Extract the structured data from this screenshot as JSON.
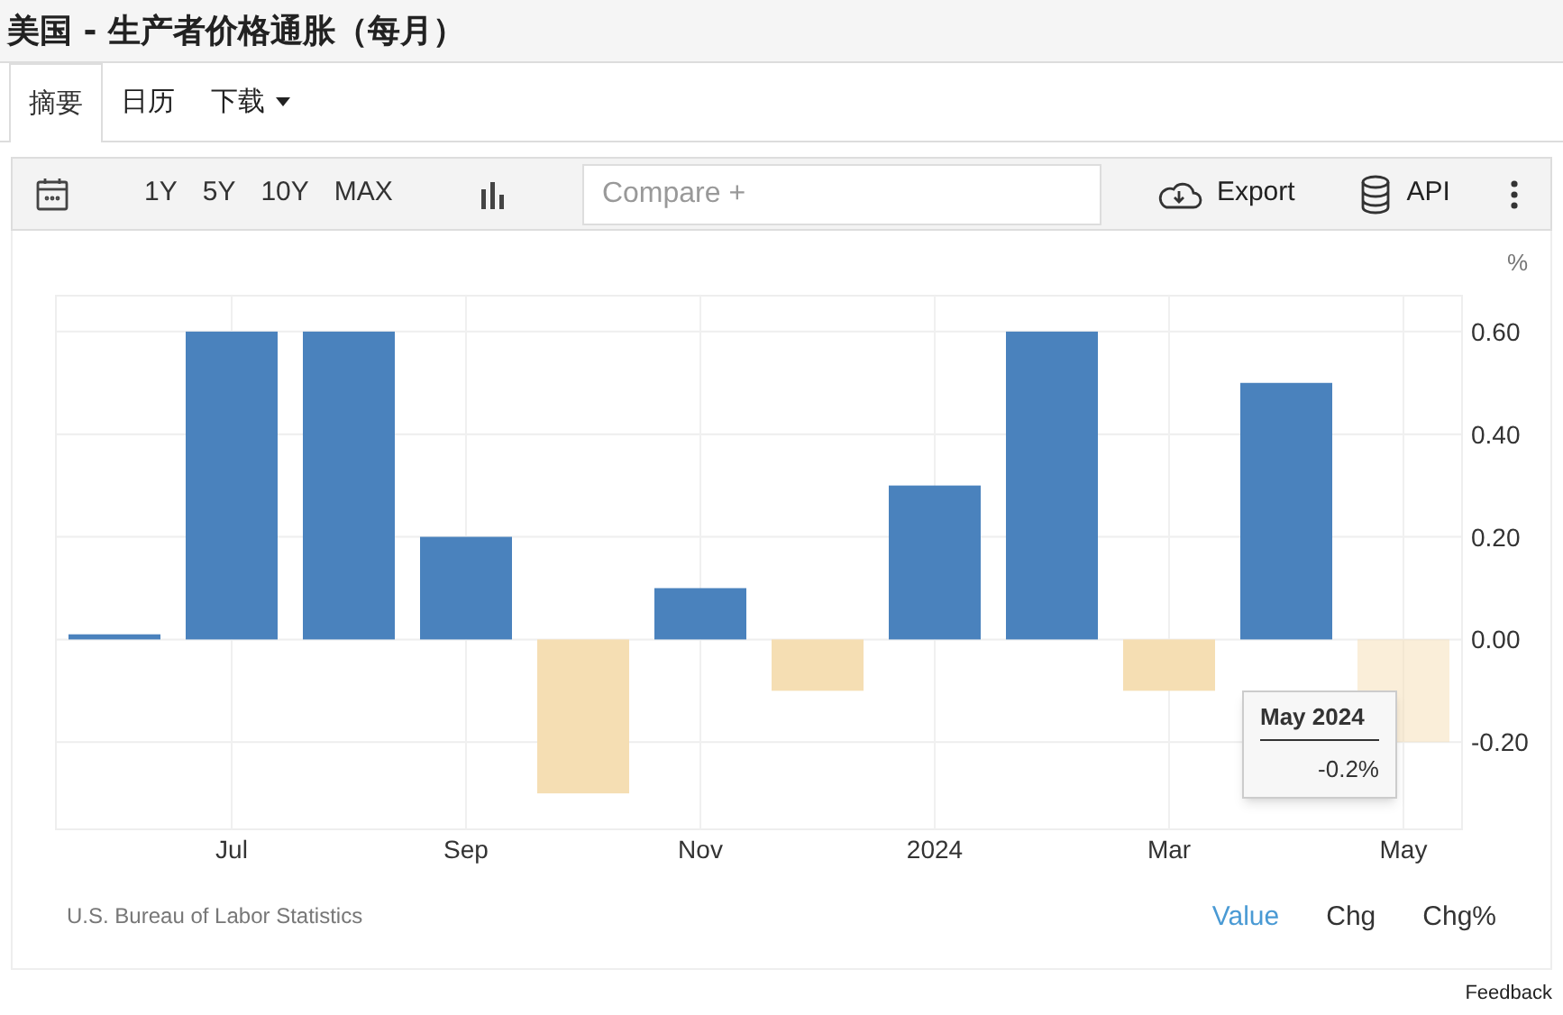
{
  "page_title": "美国 - 生产者价格通胀（每月）",
  "tabs": [
    {
      "label": "摘要",
      "selected": true,
      "dropdown": false
    },
    {
      "label": "日历",
      "selected": false,
      "dropdown": false
    },
    {
      "label": "下载",
      "selected": false,
      "dropdown": true
    }
  ],
  "toolbar": {
    "ranges": [
      "1Y",
      "5Y",
      "10Y",
      "MAX"
    ],
    "compare": {
      "placeholder": "Compare +"
    },
    "export": "Export",
    "api": "API"
  },
  "chart": {
    "unit": "%",
    "chart_data": {
      "type": "bar",
      "categories": [
        null,
        "Jul",
        null,
        "Sep",
        null,
        "Nov",
        null,
        "2024",
        null,
        "Mar",
        null,
        "May"
      ],
      "grid": true,
      "series": [
        {
          "color": "#4a82bd",
          "values": [
            0.01,
            0.6,
            0.6,
            0.2,
            null,
            0.1,
            null,
            0.3,
            0.6,
            null,
            0.5,
            null
          ]
        },
        {
          "color": "#f5deb3",
          "values": [
            null,
            null,
            null,
            null,
            -0.3,
            null,
            -0.1,
            null,
            null,
            -0.1,
            null,
            -0.2
          ]
        }
      ],
      "ylim": [
        -0.37,
        0.67
      ],
      "yticks": [
        {
          "value": 0.6,
          "label": "0.60"
        },
        {
          "value": 0.4,
          "label": "0.40"
        },
        {
          "value": 0.2,
          "label": "0.20"
        },
        {
          "value": 0,
          "label": "0.00"
        },
        {
          "value": -0.2,
          "label": "-0.20"
        }
      ]
    },
    "tooltip": {
      "title": "May 2024",
      "value": "-0.2%"
    },
    "source": "U.S. Bureau of Labor Statistics",
    "modes": [
      {
        "label": "Value",
        "selected": true
      },
      {
        "label": "Chg",
        "selected": false
      },
      {
        "label": "Chg%",
        "selected": false
      }
    ]
  },
  "feedback": "Feedback"
}
